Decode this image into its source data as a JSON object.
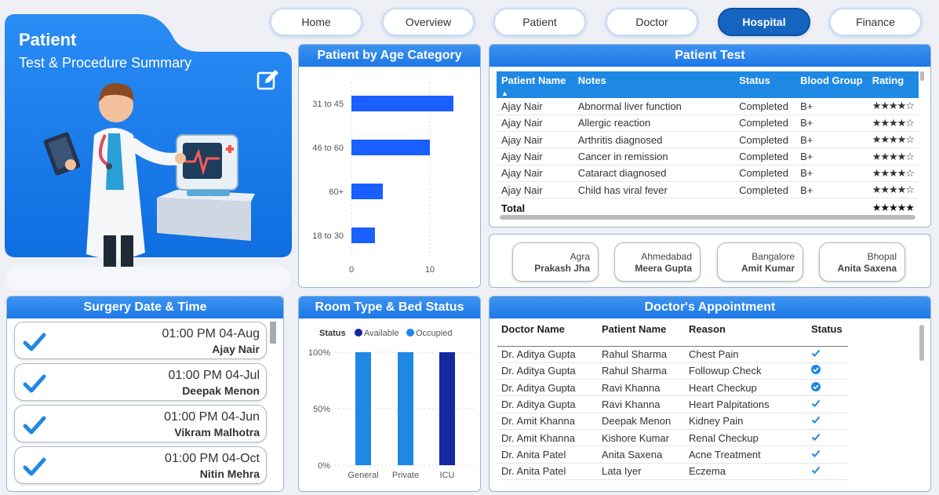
{
  "colors": {
    "primary": "#1e88e5",
    "active_nav": "#1565c0",
    "occupied": "#1e88e5",
    "available": "#1428a0"
  },
  "nav": [
    {
      "label": "Home",
      "active": false
    },
    {
      "label": "Overview",
      "active": false
    },
    {
      "label": "Patient",
      "active": false
    },
    {
      "label": "Doctor",
      "active": false
    },
    {
      "label": "Hospital",
      "active": true
    },
    {
      "label": "Finance",
      "active": false
    }
  ],
  "hero": {
    "title": "Patient",
    "subtitle": "Test & Procedure Summary",
    "edit_icon": "edit-icon"
  },
  "age_chart": {
    "title": "Patient by Age Category"
  },
  "patient_test": {
    "title": "Patient Test",
    "columns": [
      "Patient Name",
      "Notes",
      "Status",
      "Blood Group",
      "Rating"
    ],
    "rows": [
      {
        "name": "Ajay Nair",
        "notes": "Abnormal liver function",
        "status": "Completed",
        "blood": "B+",
        "rating": "★★★★☆"
      },
      {
        "name": "Ajay Nair",
        "notes": "Allergic reaction",
        "status": "Completed",
        "blood": "B+",
        "rating": "★★★★☆"
      },
      {
        "name": "Ajay Nair",
        "notes": "Arthritis diagnosed",
        "status": "Completed",
        "blood": "B+",
        "rating": "★★★★☆"
      },
      {
        "name": "Ajay Nair",
        "notes": "Cancer in remission",
        "status": "Completed",
        "blood": "B+",
        "rating": "★★★★☆"
      },
      {
        "name": "Ajay Nair",
        "notes": "Cataract diagnosed",
        "status": "Completed",
        "blood": "B+",
        "rating": "★★★★☆"
      },
      {
        "name": "Ajay Nair",
        "notes": "Child has viral fever",
        "status": "Completed",
        "blood": "B+",
        "rating": "★★★★☆"
      }
    ],
    "total_label": "Total",
    "total_rating": "★★★★★"
  },
  "cities": [
    {
      "city": "Agra",
      "person": "Prakash Jha"
    },
    {
      "city": "Ahmedabad",
      "person": "Meera Gupta"
    },
    {
      "city": "Bangalore",
      "person": "Amit Kumar"
    },
    {
      "city": "Bhopal",
      "person": "Anita Saxena"
    }
  ],
  "surgery": {
    "title": "Surgery Date & Time",
    "items": [
      {
        "datetime": "01:00 PM 04-Aug",
        "name": "Ajay Nair"
      },
      {
        "datetime": "01:00 PM 04-Jul",
        "name": "Deepak Menon"
      },
      {
        "datetime": "01:00 PM 04-Jun",
        "name": "Vikram Malhotra"
      },
      {
        "datetime": "01:00 PM 04-Oct",
        "name": "Nitin Mehra"
      }
    ]
  },
  "room_chart": {
    "title": "Room Type & Bed Status"
  },
  "doctor_appointment": {
    "title": "Doctor's Appointment",
    "columns": [
      "Doctor Name",
      "Patient Name",
      "Reason",
      "Status"
    ],
    "rows": [
      {
        "doctor": "Dr. Aditya Gupta",
        "patient": "Rahul Sharma",
        "reason": "Chest Pain",
        "status_icon": "check-icon"
      },
      {
        "doctor": "Dr. Aditya Gupta",
        "patient": "Rahul Sharma",
        "reason": "Followup Check",
        "status_icon": "check-circle-icon"
      },
      {
        "doctor": "Dr. Aditya Gupta",
        "patient": "Ravi Khanna",
        "reason": "Heart Checkup",
        "status_icon": "check-circle-icon"
      },
      {
        "doctor": "Dr. Aditya Gupta",
        "patient": "Ravi Khanna",
        "reason": "Heart Palpitations",
        "status_icon": "check-icon"
      },
      {
        "doctor": "Dr. Amit Khanna",
        "patient": "Deepak Menon",
        "reason": "Kidney Pain",
        "status_icon": "check-icon"
      },
      {
        "doctor": "Dr. Amit Khanna",
        "patient": "Kishore Kumar",
        "reason": "Renal Checkup",
        "status_icon": "check-icon"
      },
      {
        "doctor": "Dr. Anita Patel",
        "patient": "Anita Saxena",
        "reason": "Acne Treatment",
        "status_icon": "check-icon"
      },
      {
        "doctor": "Dr. Anita Patel",
        "patient": "Lata Iyer",
        "reason": "Eczema",
        "status_icon": "check-icon"
      }
    ]
  },
  "chart_data": [
    {
      "type": "bar",
      "orientation": "horizontal",
      "categories": [
        "31 to 45",
        "46 to 60",
        "60+",
        "18 to 30"
      ],
      "values": [
        13,
        10,
        4,
        3
      ],
      "x_ticks": [
        "0",
        "10"
      ],
      "xlim": [
        0,
        14
      ],
      "grid": true
    },
    {
      "type": "bar",
      "categories": [
        "General",
        "Private",
        "ICU"
      ],
      "legend_title": "Status",
      "series": [
        {
          "name": "Available",
          "values": [
            0,
            0,
            100
          ]
        },
        {
          "name": "Occupied",
          "values": [
            100,
            100,
            0
          ]
        }
      ],
      "y_ticks": [
        "100%",
        "50%",
        "0%"
      ],
      "ylim": [
        0,
        100
      ],
      "legend_position": "top",
      "grid": true
    }
  ]
}
